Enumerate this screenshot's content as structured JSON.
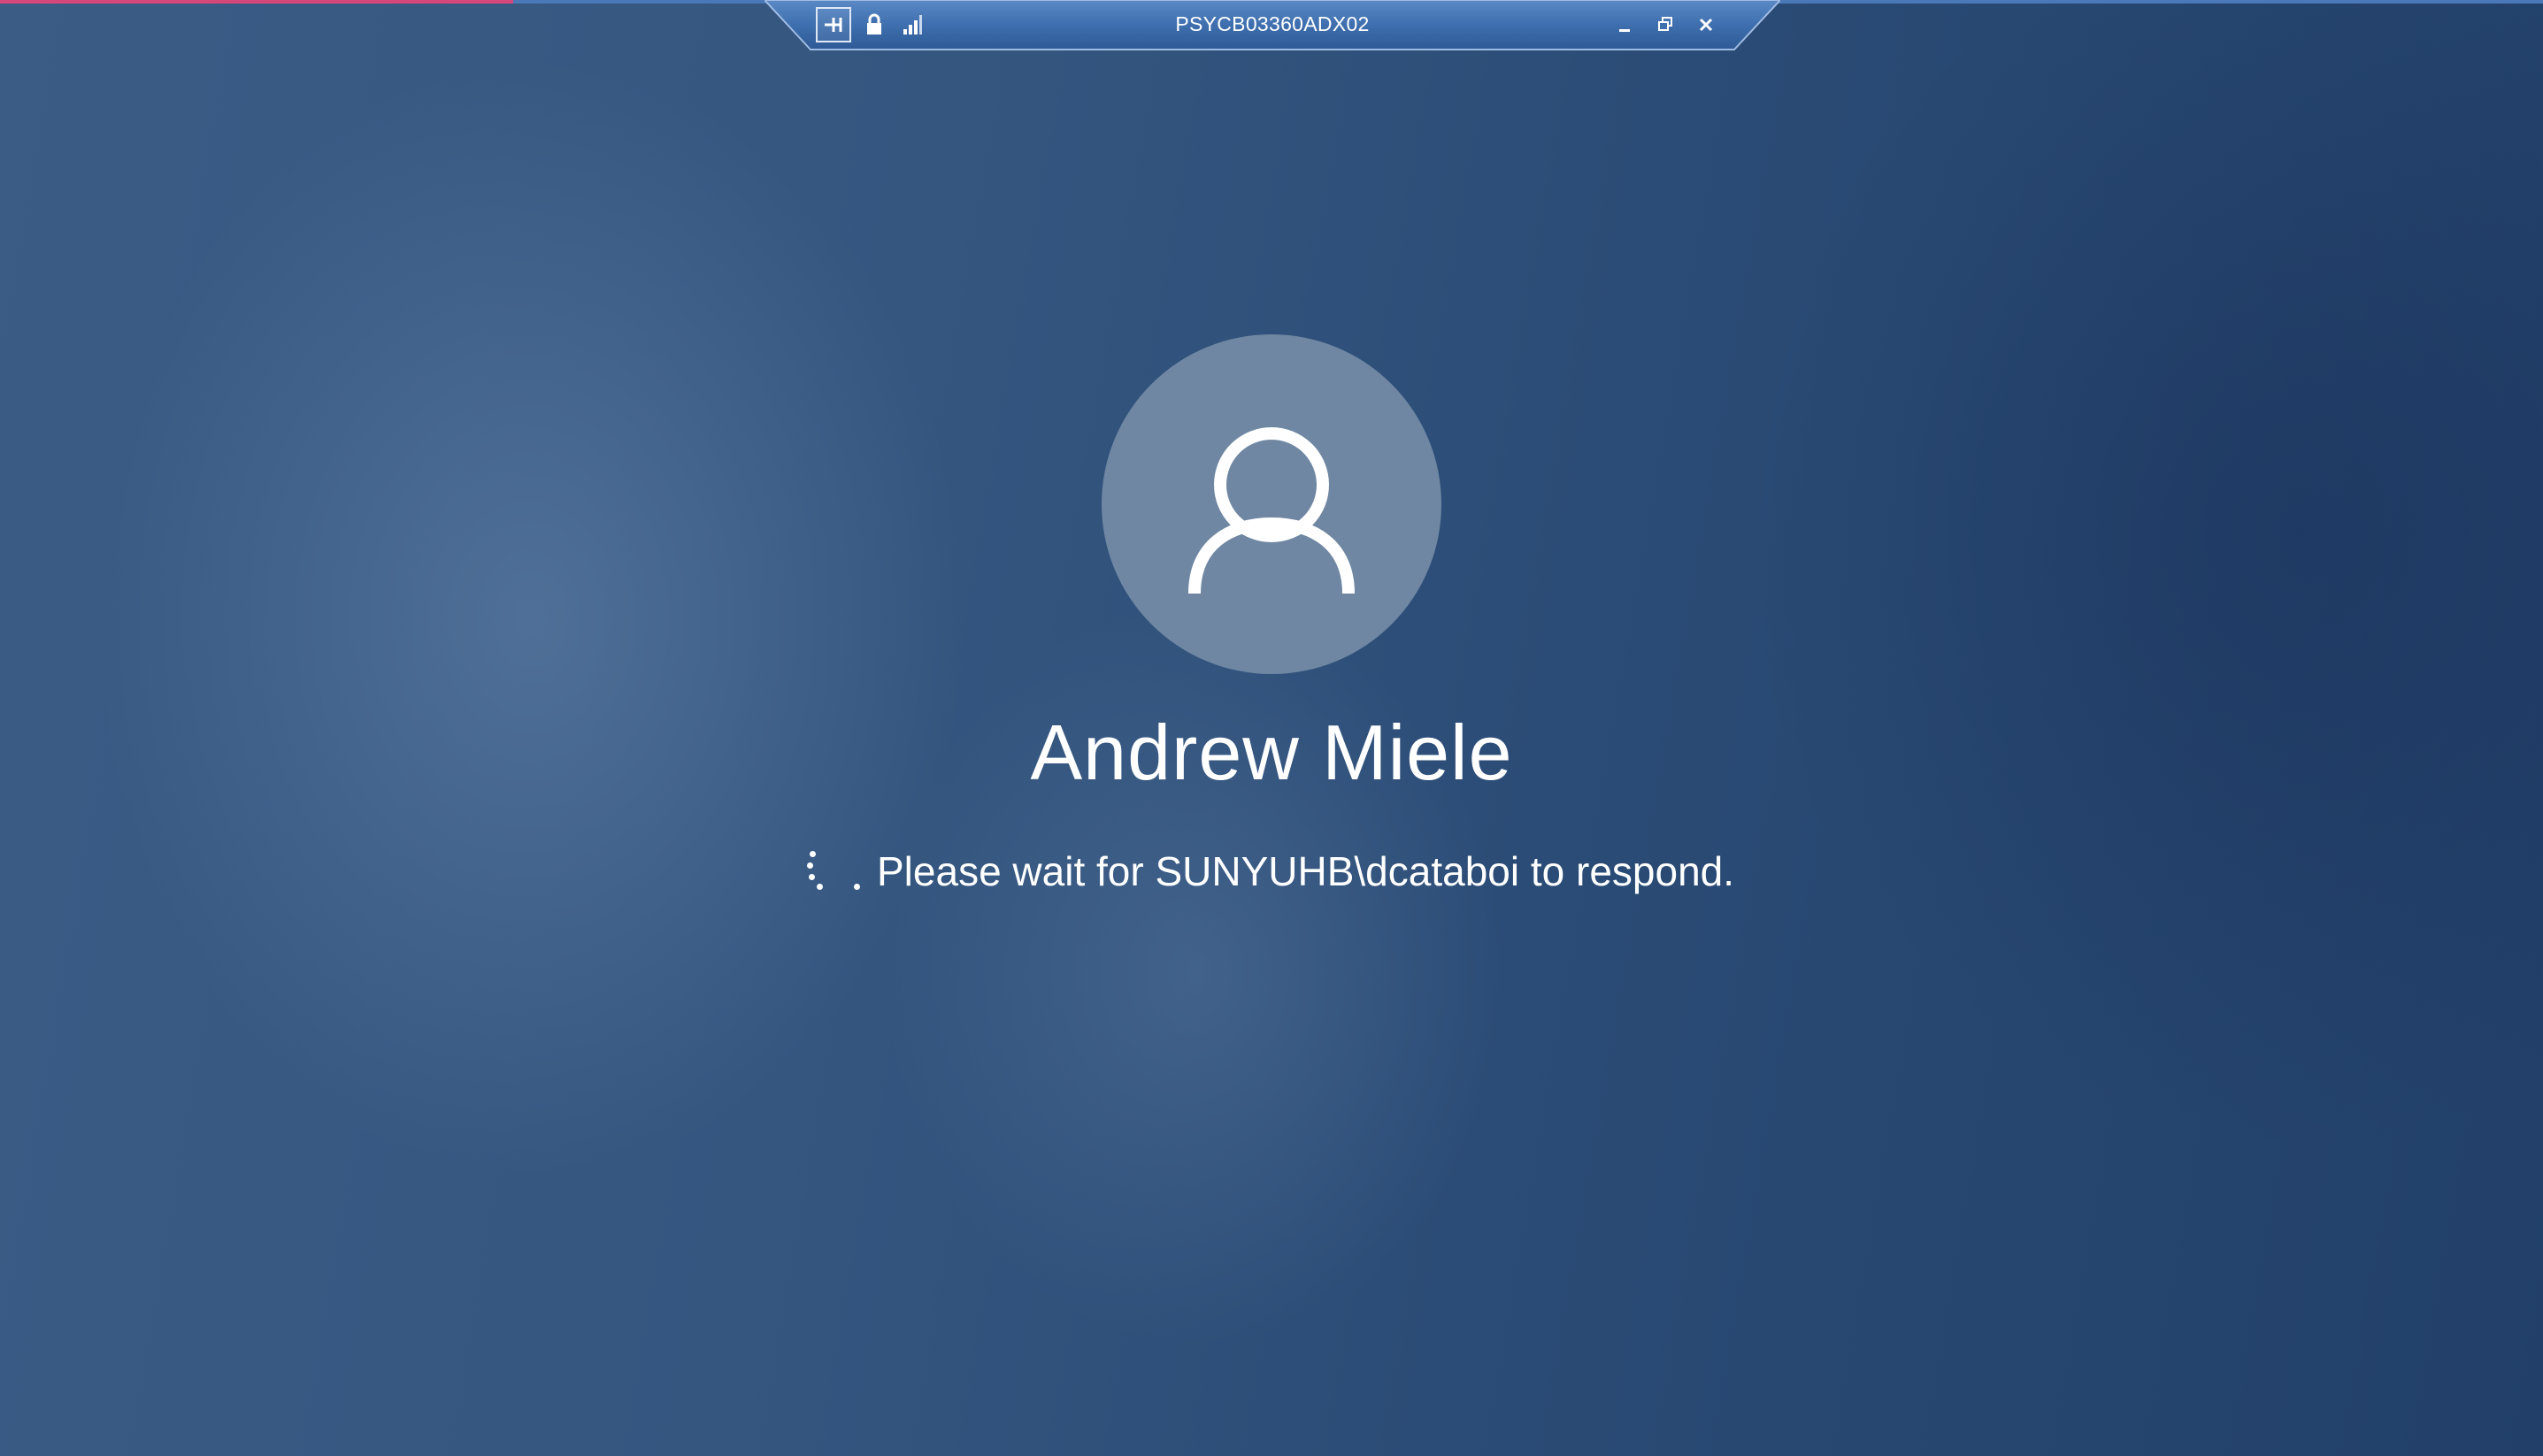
{
  "connection_bar": {
    "title": "PSYCB03360ADX02",
    "pin_icon": "pin-icon",
    "lock_icon": "lock-icon",
    "signal_icon": "signal-strength-icon",
    "minimize_icon": "minimize-icon",
    "restore_icon": "restore-icon",
    "close_icon": "close-icon"
  },
  "login": {
    "avatar_icon": "user-avatar-icon",
    "user_name": "Andrew Miele",
    "status_message": "Please wait for SUNYUHB\\dcataboi to respond.",
    "spinner_icon": "loading-spinner-icon"
  },
  "colors": {
    "background": "#2f527b",
    "avatar_circle": "#6f87a3",
    "connection_bar": "#3f6fae",
    "text": "#ffffff"
  }
}
